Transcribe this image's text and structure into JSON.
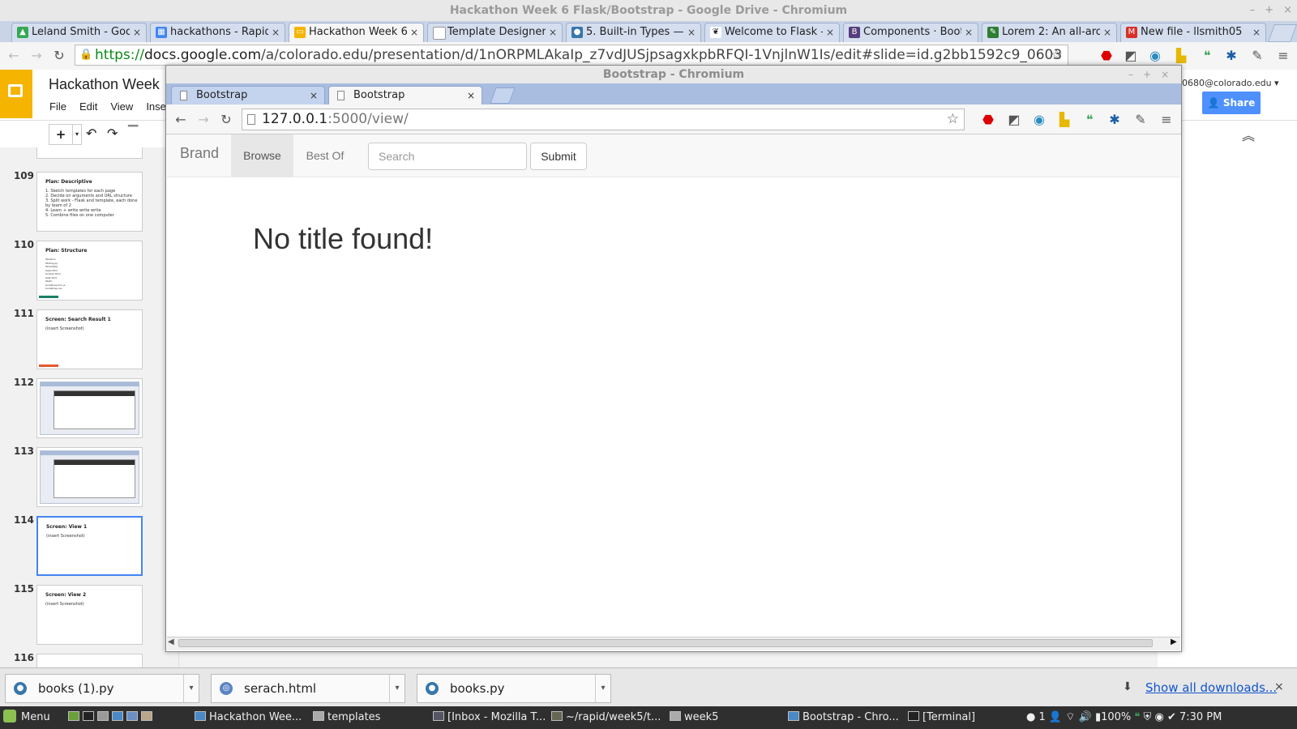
{
  "outer_window": {
    "title": "Hackathon Week 6 Flask/Bootstrap - Google Drive - Chromium",
    "tabs": [
      {
        "label": "Leland Smith - Goog",
        "icon": "drive-icon",
        "color": "#34a853"
      },
      {
        "label": "hackathons - Rapid",
        "icon": "sheets-icon",
        "color": "#4285f4"
      },
      {
        "label": "Hackathon Week 6",
        "icon": "slides-icon",
        "color": "#f4b400"
      },
      {
        "label": "Template Designer D",
        "icon": "page-icon",
        "color": "#888888"
      },
      {
        "label": "5. Built-in Types — P",
        "icon": "python-icon",
        "color": "#3776ab"
      },
      {
        "label": "Welcome to Flask —",
        "icon": "flask-icon",
        "color": "#222222"
      },
      {
        "label": "Components · Boots",
        "icon": "bootstrap-icon",
        "color": "#563d7c"
      },
      {
        "label": "Lorem 2: An all-arou",
        "icon": "lorem-icon",
        "color": "#2e7d32"
      },
      {
        "label": "New file - llsmith05",
        "icon": "gmail-icon",
        "color": "#d93025"
      }
    ],
    "url_scheme": "https://",
    "url_host": "docs.google.com",
    "url_path": "/a/colorado.edu/presentation/d/1nORPMLAkaIp_z7vdJUSjpsagxkpbRFQI-1VnjlnW1Is/edit#slide=id.g2bb1592c9_0603"
  },
  "slides_app": {
    "doc_title": "Hackathon Week",
    "menu": [
      "File",
      "Edit",
      "View",
      "Inse"
    ],
    "account": "0680@colorado.edu",
    "share_label": "Share",
    "thumbnails": [
      {
        "num": "109",
        "title": "Plan: Descriptive",
        "body": [
          "1.  Sketch templates for each page",
          "2.  Decide on arguments and URL structure",
          "3.  Split work - Flask and template, each done",
          "     by team of 2",
          "4.  Learn + write write write",
          "5.  Combine files on one computer"
        ]
      },
      {
        "num": "110",
        "title": "Plan: Structure",
        "body": [
          "Iteration",
          "   Testing.py",
          "   Templates",
          "      base.html",
          "      browse.html",
          "      best.html",
          "   Static",
          "      bootstrap.min.js",
          "      bootstrap.css"
        ]
      },
      {
        "num": "111",
        "title": "Screen: Search Result 1",
        "body": [
          "(insert Screenshot)"
        ]
      },
      {
        "num": "112",
        "title": "",
        "body": []
      },
      {
        "num": "113",
        "title": "",
        "body": []
      },
      {
        "num": "114",
        "title": "Screen: View 1",
        "body": [
          "(insert Screenshot)"
        ]
      },
      {
        "num": "115",
        "title": "Screen: View 2",
        "body": [
          "(insert Screenshot)"
        ]
      },
      {
        "num": "116",
        "title": "",
        "body": []
      }
    ]
  },
  "inner_window": {
    "title": "Bootstrap - Chromium",
    "tabs": [
      "Bootstrap",
      "Bootstrap"
    ],
    "url_host": "127.0.0.1",
    "url_path": ":5000/view/"
  },
  "page": {
    "brand": "Brand",
    "nav": [
      "Browse",
      "Best Of"
    ],
    "search_placeholder": "Search",
    "submit_label": "Submit",
    "heading": "No title found!"
  },
  "downloads": {
    "items": [
      "books (1).py",
      "serach.html",
      "books.py"
    ],
    "show_all": "Show all downloads..."
  },
  "taskbar": {
    "menu": "Menu",
    "items": [
      "Hackathon Wee...",
      "templates",
      "[Inbox - Mozilla T...",
      "~/rapid/week5/t...",
      "week5",
      "Bootstrap - Chro...",
      "[Terminal]"
    ],
    "tray_count": "1",
    "battery": "100%",
    "clock": "7:30 PM"
  }
}
